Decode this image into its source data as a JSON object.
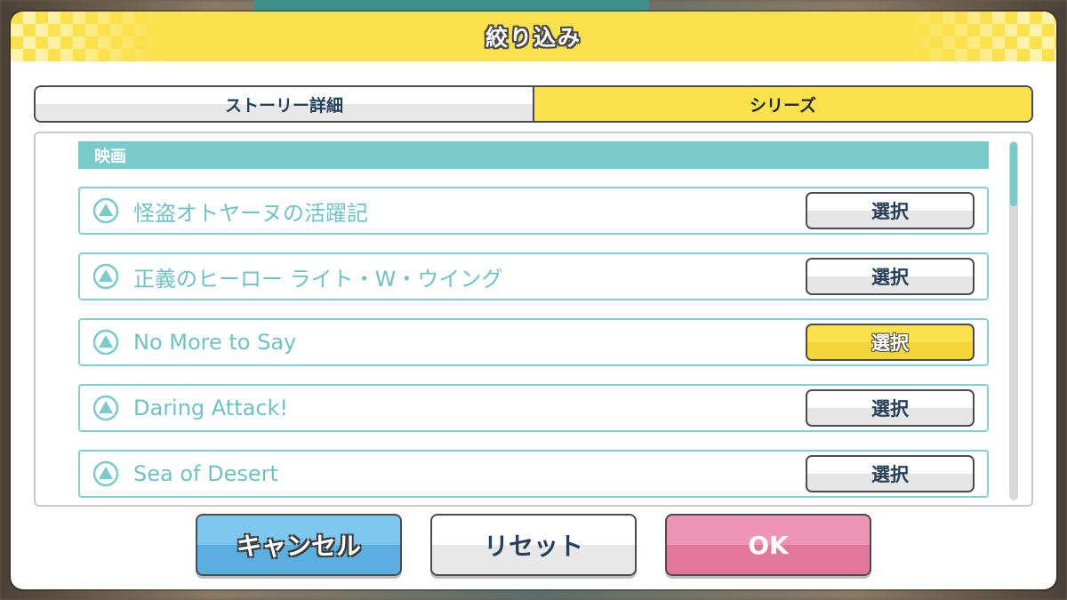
{
  "dialog": {
    "title": "絞り込み"
  },
  "tabs": [
    {
      "label": "ストーリー詳細",
      "active": false
    },
    {
      "label": "シリーズ",
      "active": true
    }
  ],
  "section": {
    "title": "映画"
  },
  "rows": [
    {
      "label": "怪盗オトヤーヌの活躍記",
      "button": "選択",
      "selected": false,
      "icon": "triangle-up-icon"
    },
    {
      "label": "正義のヒーロー ライト・W・ウイング",
      "button": "選択",
      "selected": false,
      "icon": "triangle-up-icon"
    },
    {
      "label": "No More to Say",
      "button": "選択",
      "selected": true,
      "icon": "triangle-up-icon"
    },
    {
      "label": "Daring Attack!",
      "button": "選択",
      "selected": false,
      "icon": "triangle-up-icon"
    },
    {
      "label": "Sea of Desert",
      "button": "選択",
      "selected": false,
      "icon": "triangle-up-icon"
    }
  ],
  "footer": {
    "cancel_label": "キャンセル",
    "reset_label": "リセット",
    "ok_label": "OK"
  },
  "colors": {
    "accent_yellow": "#fbe24d",
    "teal": "#79cbcc",
    "cancel_blue": "#5aaee0",
    "ok_pink": "#e2779c"
  }
}
